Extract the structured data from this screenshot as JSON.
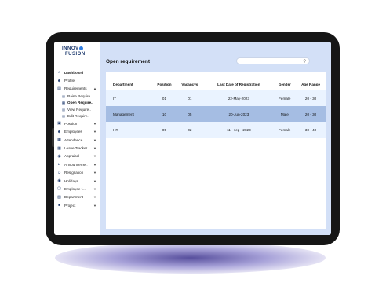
{
  "brand": {
    "line1": "INNOV",
    "line2": "FUSION"
  },
  "sidebar": {
    "items": [
      {
        "label": "Dashboard",
        "icon": "home-icon",
        "bold": true
      },
      {
        "label": "Profile",
        "icon": "user-icon"
      },
      {
        "label": "Requirements",
        "icon": "doc-icon",
        "chevron": "up"
      },
      {
        "label": "Raise Require..",
        "icon": "doc-icon",
        "sub": true
      },
      {
        "label": "Open Require..",
        "icon": "doc-icon",
        "sub": true,
        "active": true
      },
      {
        "label": "View Require..",
        "icon": "doc-icon",
        "sub": true
      },
      {
        "label": "Edit Require..",
        "icon": "doc-icon",
        "sub": true
      },
      {
        "label": "Position",
        "icon": "briefcase-icon",
        "chevron": "down"
      },
      {
        "label": "Employees",
        "icon": "users-icon",
        "chevron": "down"
      },
      {
        "label": "Attendance",
        "icon": "calendar-icon",
        "chevron": "down"
      },
      {
        "label": "Leave Tracker",
        "icon": "calendar-icon",
        "chevron": "down"
      },
      {
        "label": "Appraisal",
        "icon": "badge-icon",
        "chevron": "down"
      },
      {
        "label": "Announceme..",
        "icon": "megaphone-icon",
        "chevron": "down"
      },
      {
        "label": "Resignation",
        "icon": "user-minus-icon",
        "chevron": "down"
      },
      {
        "label": "Holidays",
        "icon": "globe-icon",
        "chevron": "down"
      },
      {
        "label": "Employee f...",
        "icon": "chat-icon",
        "chevron": "down"
      },
      {
        "label": "Department",
        "icon": "building-icon",
        "chevron": "down"
      },
      {
        "label": "Project",
        "icon": "folder-icon",
        "chevron": "down"
      }
    ]
  },
  "main": {
    "title": "Open requirement",
    "search": {
      "placeholder": ""
    },
    "table": {
      "headers": [
        "Department",
        "Position",
        "Vacancys",
        "Last Date of Registration",
        "Gender",
        "Age Range"
      ],
      "rows": [
        [
          "IT",
          "01",
          "01",
          "22-May-2023",
          "Female",
          "20 - 30"
        ],
        [
          "Management",
          "10",
          "05",
          "20-Jun-2023",
          "Male",
          "20 - 30"
        ],
        [
          "HR",
          "05",
          "02",
          "11 - sep - 2023",
          "Female",
          "30 - 40"
        ]
      ],
      "highlighted_row": 1
    }
  },
  "colors": {
    "accent": "#2f7de1",
    "main_bg": "#d3e0f7",
    "row_highlight": "#a5bde3",
    "row_bg": "#eaf3ff"
  }
}
